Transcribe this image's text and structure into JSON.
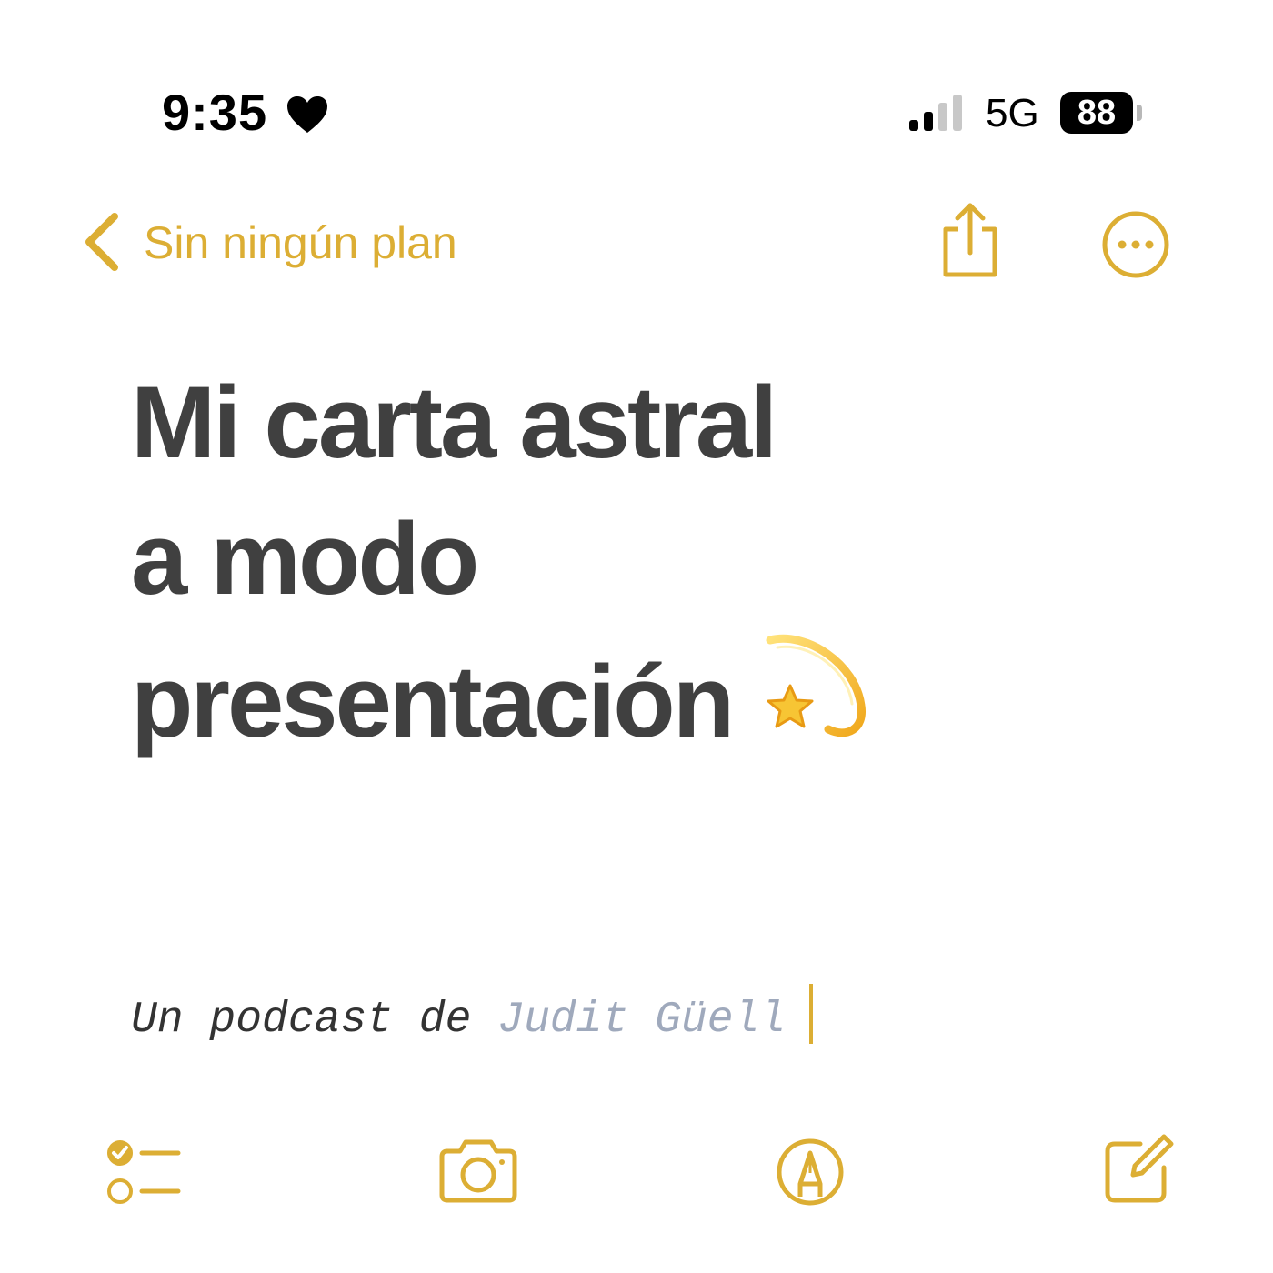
{
  "status_bar": {
    "time": "9:35",
    "network": "5G",
    "battery": "88",
    "icons": [
      "heart-icon",
      "signal-icon",
      "battery-icon"
    ]
  },
  "nav": {
    "back_label": "Sin ningún plan",
    "icons": [
      "chevron-left-icon",
      "share-icon",
      "more-icon"
    ]
  },
  "note": {
    "title_lines": [
      "Mi carta astral",
      "a modo",
      "presentación"
    ],
    "emoji": "shooting-star-icon",
    "subtitle_prefix": "Un podcast de ",
    "subtitle_author": "Judit Güell"
  },
  "toolbar": {
    "icons": [
      "checklist-icon",
      "camera-icon",
      "markup-icon",
      "compose-icon"
    ]
  },
  "colors": {
    "accent": "#dcae34",
    "title": "#404040",
    "author": "#9fa9bc",
    "status": "#000000"
  }
}
